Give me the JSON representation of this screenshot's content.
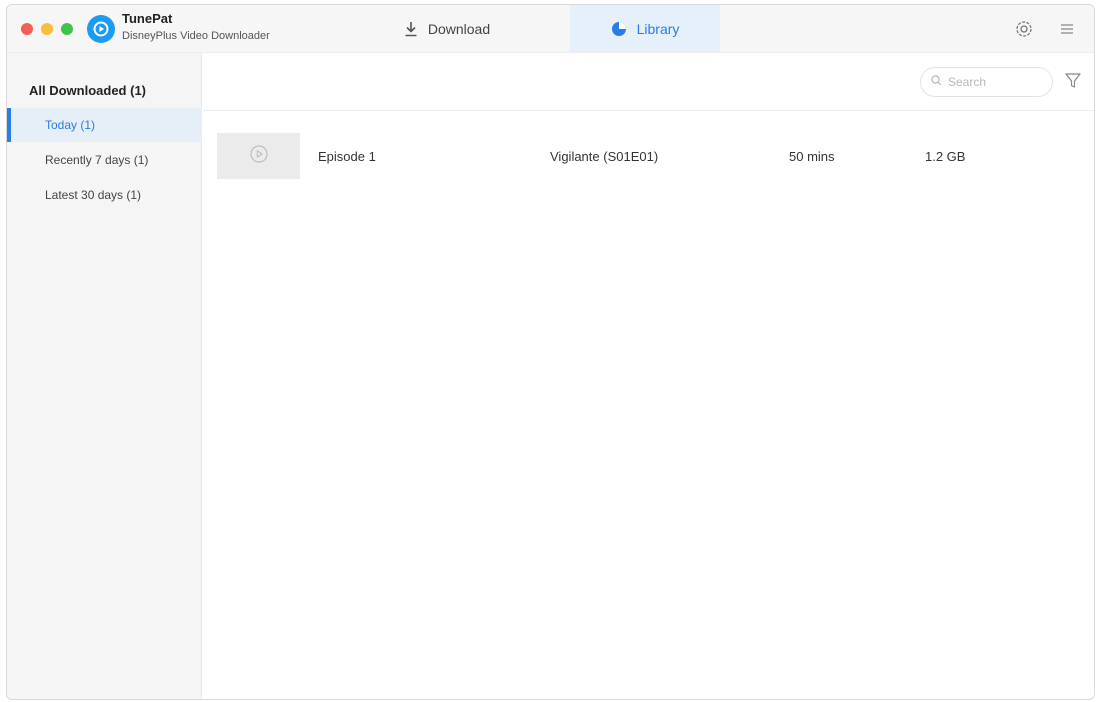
{
  "app": {
    "name": "TunePat",
    "subtitle": "DisneyPlus Video Downloader"
  },
  "tabs": {
    "download": "Download",
    "library": "Library"
  },
  "sidebar": {
    "header": "All Downloaded (1)",
    "items": [
      {
        "label": "Today (1)",
        "active": true
      },
      {
        "label": "Recently 7 days (1)",
        "active": false
      },
      {
        "label": "Latest 30 days (1)",
        "active": false
      }
    ]
  },
  "search": {
    "placeholder": "Search"
  },
  "library_rows": [
    {
      "title": "Episode 1",
      "series": "Vigilante (S01E01)",
      "duration": "50 mins",
      "size": "1.2 GB"
    }
  ],
  "colors": {
    "accent": "#2a7de1",
    "logo": "#1a9cf2",
    "traffic_red": "#f25f58",
    "traffic_yellow": "#f8be3c",
    "traffic_green": "#3ec44b"
  },
  "icons": [
    "app-logo-icon",
    "download-icon",
    "library-icon",
    "gear-icon",
    "menu-icon",
    "search-icon",
    "filter-icon",
    "play-icon"
  ]
}
